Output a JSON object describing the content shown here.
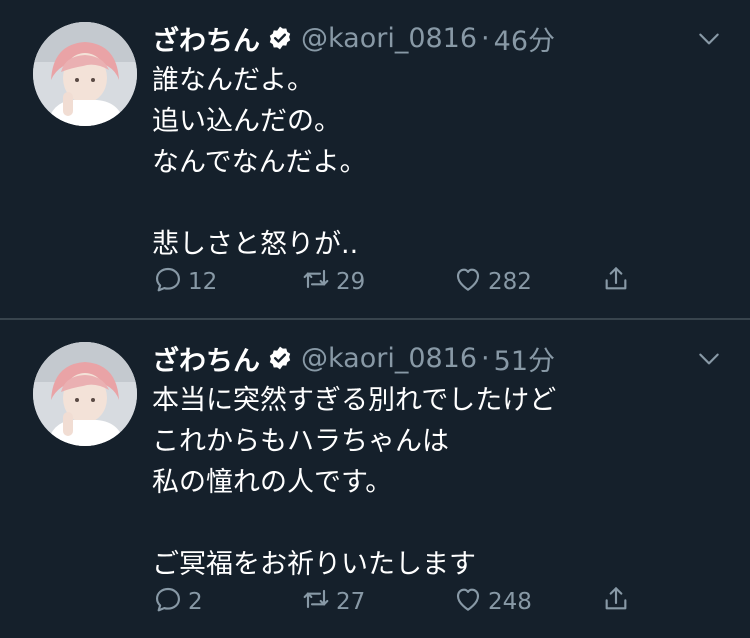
{
  "tweets": [
    {
      "display_name": "ざわちん",
      "handle": "@kaori_0816",
      "separator": "·",
      "time": "46分",
      "lines": [
        "誰なんだよ。",
        "追い込んだの。",
        "なんでなんだよ。",
        "",
        "悲しさと怒りが.."
      ],
      "replies": "12",
      "retweets": "29",
      "likes": "282"
    },
    {
      "display_name": "ざわちん",
      "handle": "@kaori_0816",
      "separator": "·",
      "time": "51分",
      "lines": [
        "本当に突然すぎる別れでしたけど",
        "これからもハラちゃんは",
        "私の憧れの人です。",
        "",
        "ご冥福をお祈りいたします"
      ],
      "replies": "2",
      "retweets": "27",
      "likes": "248"
    }
  ],
  "icons": {
    "verified": "verified-badge-icon",
    "caret": "chevron-down-icon",
    "reply": "reply-icon",
    "retweet": "retweet-icon",
    "like": "heart-icon",
    "share": "share-icon"
  },
  "colors": {
    "background": "#15202b",
    "text": "#ffffff",
    "muted": "#8899a6",
    "divider": "#38444d"
  }
}
